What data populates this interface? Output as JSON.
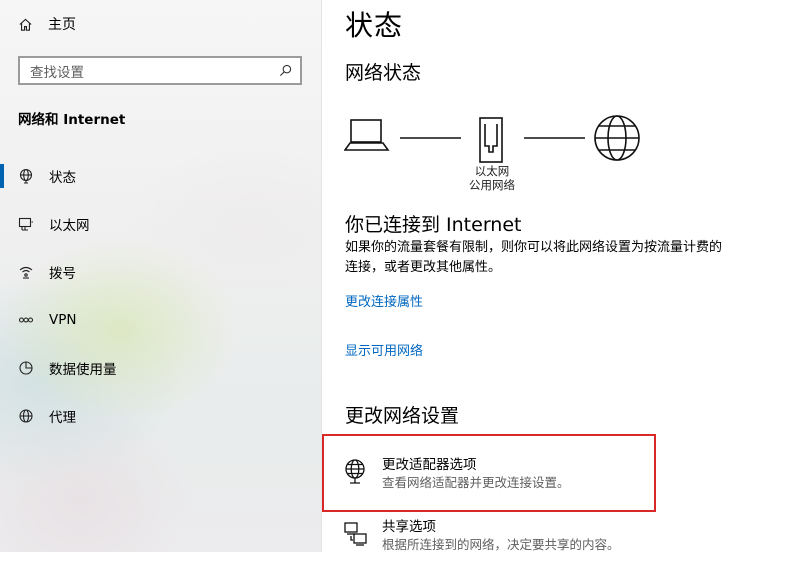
{
  "sidebar": {
    "home_label": "主页",
    "search_placeholder": "查找设置",
    "section_title": "网络和 Internet",
    "items": [
      {
        "label": "状态",
        "icon": "globe-icon"
      },
      {
        "label": "以太网",
        "icon": "ethernet-icon"
      },
      {
        "label": "拨号",
        "icon": "dialup-icon"
      },
      {
        "label": "VPN",
        "icon": "vpn-icon"
      },
      {
        "label": "数据使用量",
        "icon": "data-usage-icon"
      },
      {
        "label": "代理",
        "icon": "proxy-globe-icon"
      }
    ],
    "active_index": 0
  },
  "main": {
    "title": "状态",
    "network_status_title": "网络状态",
    "diagram": {
      "adapter_name": "以太网",
      "network_type": "公用网络"
    },
    "connected_title": "你已连接到 Internet",
    "connected_desc_line1": "如果你的流量套餐有限制，则你可以将此网络设置为按流量计费的",
    "connected_desc_line2": "连接，或者更改其他属性。",
    "link_change_properties": "更改连接属性",
    "link_show_networks": "显示可用网络",
    "change_settings_title": "更改网络设置",
    "options": [
      {
        "title": "更改适配器选项",
        "subtitle": "查看网络适配器并更改连接设置。",
        "icon": "adapter-globe-icon"
      },
      {
        "title": "共享选项",
        "subtitle": "根据所连接到的网络，决定要共享的内容。",
        "icon": "sharing-icon"
      }
    ],
    "highlight_color": "#d92828",
    "accent_color": "#0063b1",
    "link_color": "#0067c0"
  }
}
